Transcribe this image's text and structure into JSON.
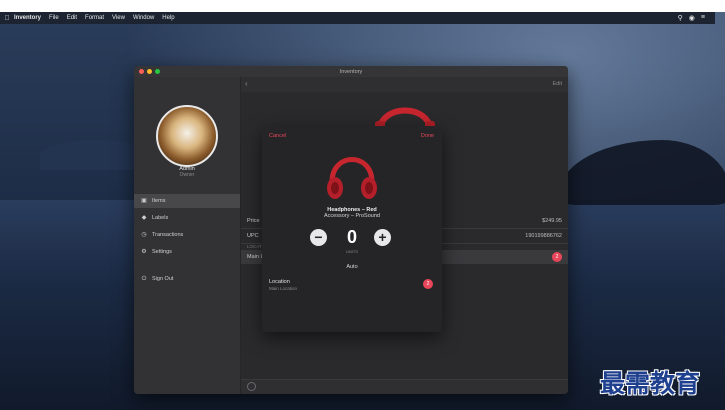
{
  "menubar": {
    "app": "Inventory",
    "items": [
      "File",
      "Edit",
      "Format",
      "View",
      "Window",
      "Help"
    ]
  },
  "window": {
    "title": "Inventory",
    "edit_label": "Edit"
  },
  "sidebar": {
    "user_name": "Admin",
    "user_role": "Owner",
    "items": [
      {
        "label": "Items",
        "icon": "box-icon"
      },
      {
        "label": "Labels",
        "icon": "tag-icon"
      },
      {
        "label": "Transactions",
        "icon": "clock-icon"
      },
      {
        "label": "Settings",
        "icon": "gear-icon"
      },
      {
        "label": "Sign Out",
        "icon": "power-icon"
      }
    ]
  },
  "detail": {
    "price_label": "Price",
    "price_value": "$249.95",
    "upc_label": "UPC",
    "upc_value": "190199886762",
    "section_header": "LOCATIONS",
    "location_row": "Main Location",
    "location_badge": "2"
  },
  "modal": {
    "cancel_label": "Cancel",
    "done_label": "Done",
    "item_name": "Headphones – Red",
    "item_category": "Accessory – ProSound",
    "quantity": "0",
    "units_label": "UNITS",
    "mode": "Auto",
    "location_label": "Location",
    "location_value": "Main Location",
    "location_badge": "2"
  },
  "colors": {
    "accent": "#e8465a",
    "window_bg": "#2c2c2e",
    "sidebar_bg": "#323234"
  },
  "watermark": "最需教育"
}
